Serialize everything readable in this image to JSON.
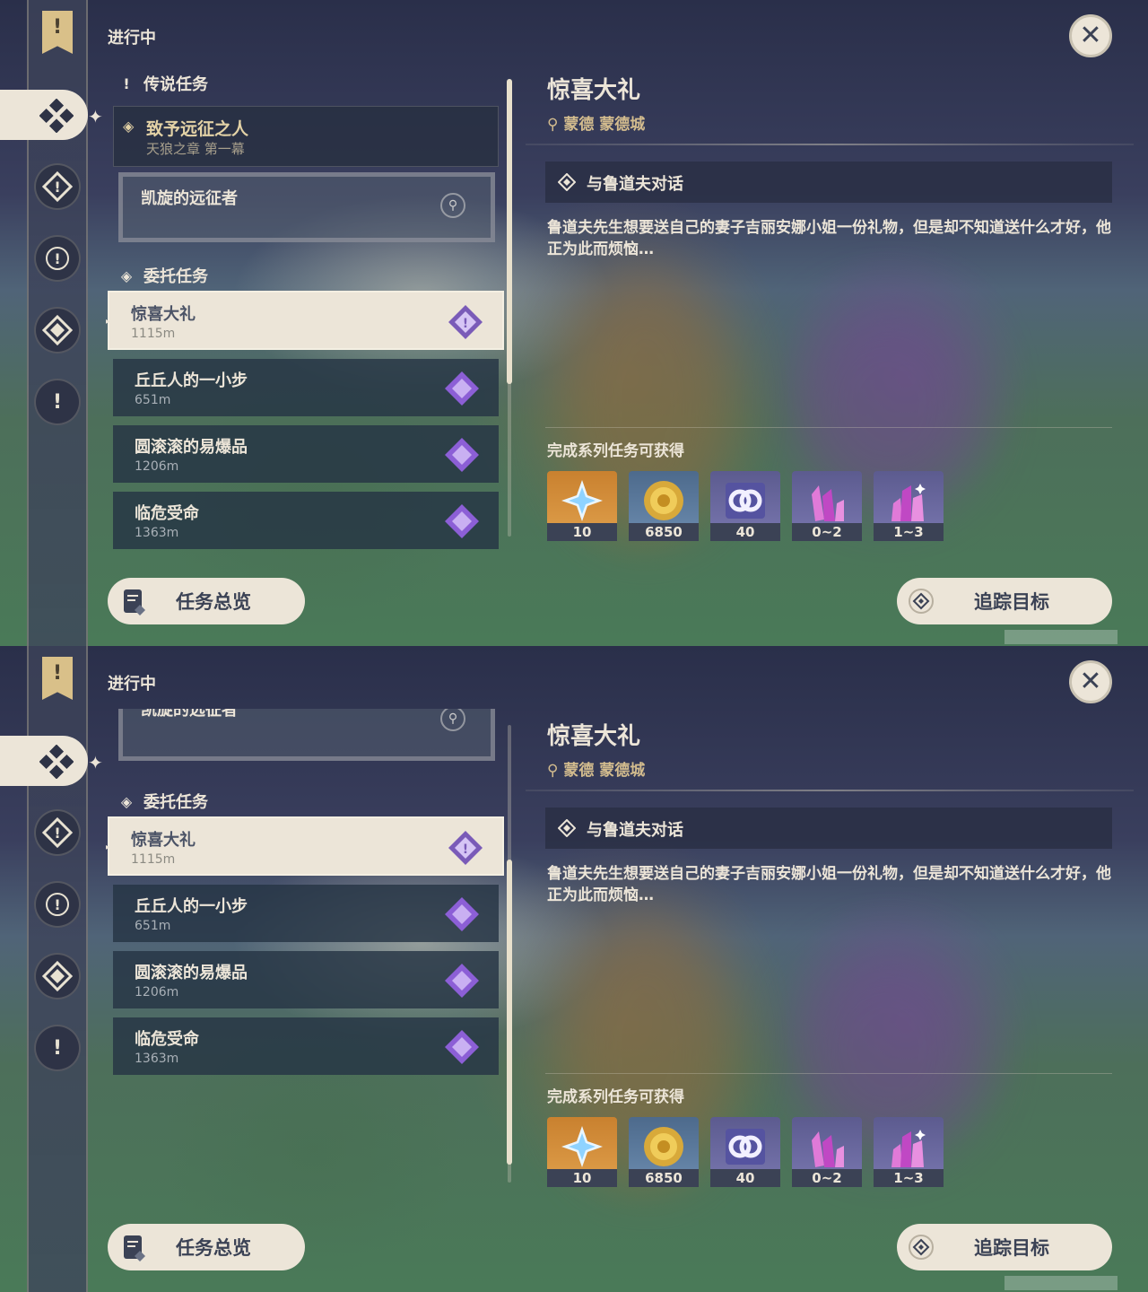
{
  "colors": {
    "cream": "#ece5d8",
    "gold": "#d3bc8e",
    "dark": "#3b4255",
    "purple": "#9b6ed8"
  },
  "header": {
    "title": "进行中",
    "close_icon": "close-icon"
  },
  "sections": {
    "legend": {
      "label": "传说任务"
    },
    "commission": {
      "label": "委托任务"
    }
  },
  "legend_quest": {
    "name": "致予远征之人",
    "chapter": "天狼之章 第一幕",
    "sub": "凯旋的远征者",
    "sub_clipped": "凯旋的远征者"
  },
  "quests": [
    {
      "name": "惊喜大礼",
      "distance": "1115m",
      "active": true
    },
    {
      "name": "丘丘人的一小步",
      "distance": "651m",
      "active": false
    },
    {
      "name": "圆滚滚的易爆品",
      "distance": "1206m",
      "active": false
    },
    {
      "name": "临危受命",
      "distance": "1363m",
      "active": false
    }
  ],
  "detail": {
    "title": "惊喜大礼",
    "location": "蒙德 蒙德城",
    "step": "与鲁道夫对话",
    "description": "鲁道夫先生想要送自己的妻子吉丽安娜小姐一份礼物，但是却不知道送什么才好，他正为此而烦恼…",
    "rewards_title": "完成系列任务可获得",
    "rewards": [
      {
        "icon": "primogem-icon",
        "count": "10"
      },
      {
        "icon": "mora-icon",
        "count": "6850"
      },
      {
        "icon": "companionship-exp-icon",
        "count": "40"
      },
      {
        "icon": "crystal-chunk-icon",
        "count": "0~2"
      },
      {
        "icon": "crystal-cluster-icon",
        "count": "1~3"
      }
    ]
  },
  "buttons": {
    "overview": "任务总览",
    "track": "追踪目标"
  },
  "scroll": {
    "panel1_position": 0.0,
    "panel2_position": 0.35
  }
}
